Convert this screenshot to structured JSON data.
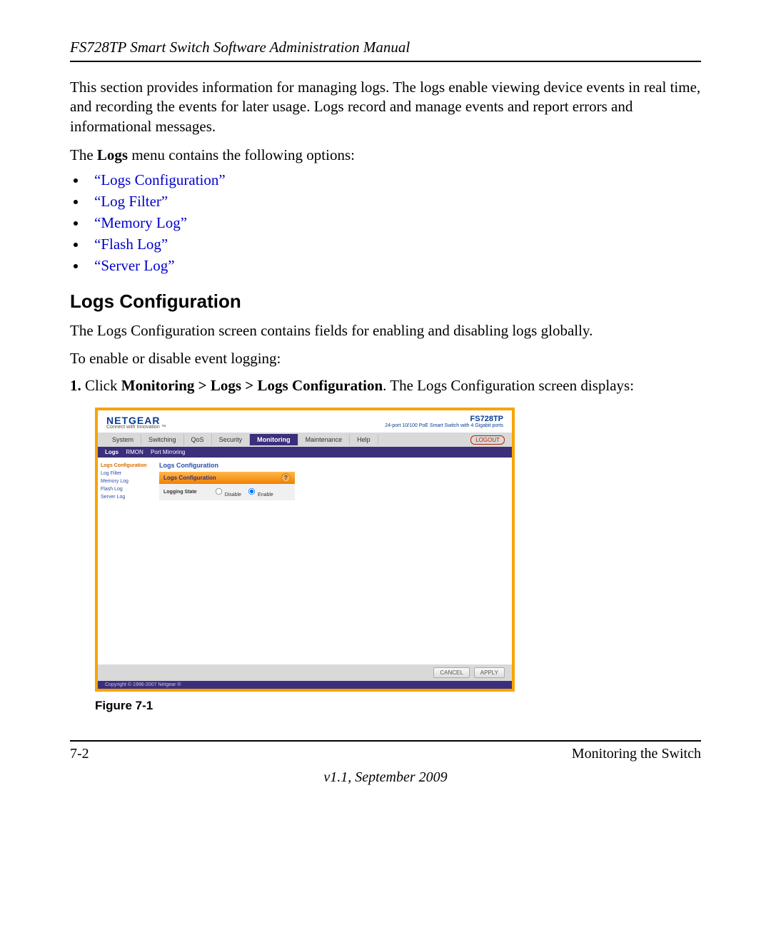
{
  "doc_title": "FS728TP Smart Switch Software Administration Manual",
  "intro": "This section provides information for managing logs. The logs enable viewing device events in real time, and recording the events for later usage. Logs record and manage events and report errors and informational messages.",
  "menu_lead_pre": "The ",
  "menu_lead_bold": "Logs",
  "menu_lead_post": " menu contains the following options:",
  "links": [
    "“Logs Configuration”",
    "“Log Filter”",
    "“Memory Log”",
    "“Flash Log”",
    "“Server Log”"
  ],
  "section_heading": "Logs Configuration",
  "body1": "The Logs Configuration screen contains fields for enabling and disabling logs globally.",
  "body2": "To enable or disable event logging:",
  "step_num": "1.",
  "step_pre": " Click ",
  "step_bold": "Monitoring > Logs > Logs Configuration",
  "step_post": ". The Logs Configuration screen displays:",
  "figure_caption": "Figure 7-1",
  "footer_left": "7-2",
  "footer_right": "Monitoring the Switch",
  "version": "v1.1, September 2009",
  "shot": {
    "brand_name": "NETGEAR",
    "brand_tag": "Connect with Innovation ™",
    "model_name": "FS728TP",
    "model_desc": "24-port 10/100 PoE Smart Switch with 4 Gigabit ports",
    "logout": "LOGOUT",
    "tabs": [
      "System",
      "Switching",
      "QoS",
      "Security",
      "Monitoring",
      "Maintenance",
      "Help"
    ],
    "active_tab_index": 4,
    "subtabs": [
      "Logs",
      "RMON",
      "Port Mirroring"
    ],
    "active_subtab_index": 0,
    "sidebar": [
      "Logs Configuration",
      "Log Filter",
      "Memory Log",
      "Flash Log",
      "Server Log"
    ],
    "active_sidebar_index": 0,
    "panel_title": "Logs Configuration",
    "panel_header": "Logs Configuration",
    "row_label": "Logging State",
    "radio_disable": "Disable",
    "radio_enable": "Enable",
    "btn_cancel": "CANCEL",
    "btn_apply": "APPLY",
    "copyright": "Copyright © 1996-2007 Netgear ®"
  }
}
